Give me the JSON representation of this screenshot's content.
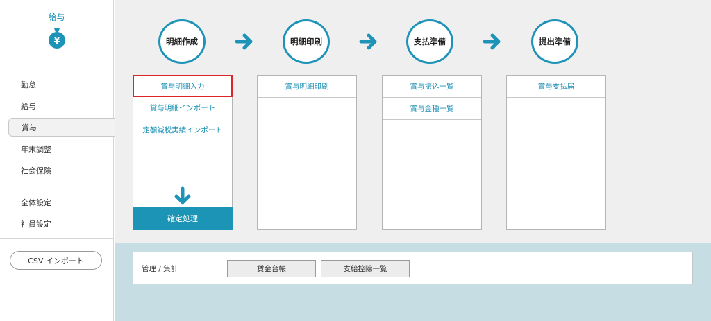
{
  "sidebar": {
    "brand_title": "給与",
    "brand_icon_symbol": "¥",
    "nav_group1": [
      {
        "label": "勤怠",
        "active": false
      },
      {
        "label": "給与",
        "active": false
      },
      {
        "label": "賞与",
        "active": true
      },
      {
        "label": "年末調整",
        "active": false
      },
      {
        "label": "社会保険",
        "active": false
      }
    ],
    "nav_group2": [
      {
        "label": "全体設定"
      },
      {
        "label": "社員設定"
      }
    ],
    "csv_import_label": "CSV インポート"
  },
  "steps": [
    {
      "label": "明細作成"
    },
    {
      "label": "明細印刷"
    },
    {
      "label": "支払準備"
    },
    {
      "label": "提出準備"
    }
  ],
  "columns": [
    {
      "items": [
        "賞与明細入力",
        "賞与明細インポート",
        "定額減税実績インポート"
      ],
      "confirm_label": "確定処理"
    },
    {
      "items": [
        "賞与明細印刷"
      ]
    },
    {
      "items": [
        "賞与振込一覧",
        "賞与金種一覧"
      ]
    },
    {
      "items": [
        "賞与支払届"
      ]
    }
  ],
  "management": {
    "label": "管理 / 集計",
    "buttons": [
      "賃金台帳",
      "支給控除一覧"
    ]
  },
  "colors": {
    "accent": "#1e93b8",
    "selected_border": "#d9262b",
    "bottom_bg": "#c5dde3"
  }
}
